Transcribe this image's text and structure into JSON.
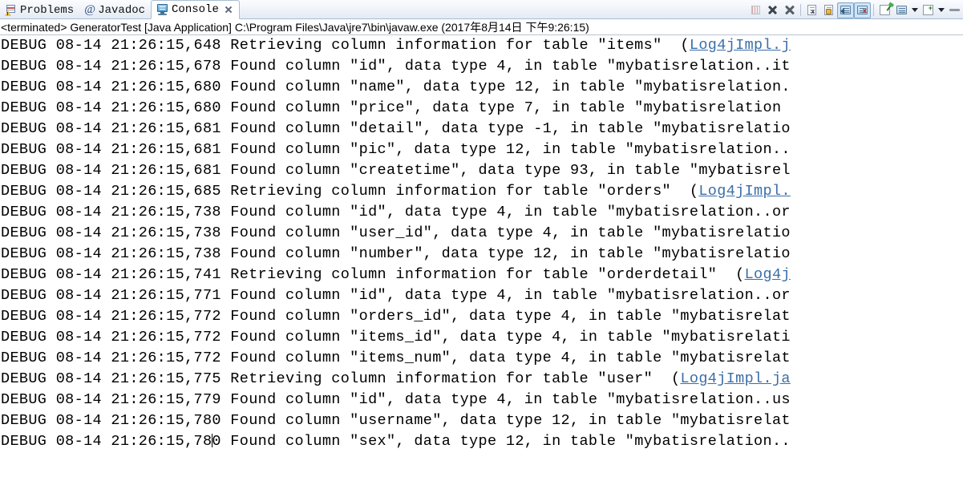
{
  "tabs": [
    {
      "label": "Problems",
      "icon": "problems-icon",
      "active": false,
      "closable": false
    },
    {
      "label": "Javadoc",
      "icon": "javadoc-icon",
      "active": false,
      "closable": false
    },
    {
      "label": "Console",
      "icon": "console-icon",
      "active": true,
      "closable": true
    }
  ],
  "toolbar": {
    "buttons": [
      {
        "name": "terminate-all-button",
        "icon": "bars-icon",
        "toggled": false
      },
      {
        "name": "remove-launch-button",
        "icon": "x-icon",
        "toggled": false
      },
      {
        "name": "remove-all-terminated-button",
        "icon": "double-x-icon",
        "toggled": false
      },
      {
        "name": "clear-console-button",
        "icon": "clear-console-icon",
        "toggled": false
      },
      {
        "name": "scroll-lock-button",
        "icon": "scroll-lock-icon",
        "toggled": false
      },
      {
        "name": "show-console-on-output-button",
        "icon": "show-console-output-icon",
        "toggled": true
      },
      {
        "name": "show-console-on-error-button",
        "icon": "show-console-error-icon",
        "toggled": true
      },
      {
        "name": "pin-console-button",
        "icon": "pin-console-icon",
        "toggled": false
      },
      {
        "name": "display-selected-console-button",
        "icon": "display-console-icon",
        "toggled": false
      },
      {
        "name": "display-selected-console-menu-button",
        "icon": "chevron-down-icon",
        "toggled": false
      },
      {
        "name": "open-console-button",
        "icon": "new-console-icon",
        "toggled": false
      },
      {
        "name": "open-console-menu-button",
        "icon": "chevron-down-icon",
        "toggled": false
      },
      {
        "name": "minimize-view-button",
        "icon": "minimize-icon",
        "toggled": false
      }
    ]
  },
  "process": {
    "header": "<terminated> GeneratorTest [Java Application] C:\\Program Files\\Java\\jre7\\bin\\javaw.exe (2017年8月14日 下午9:26:15)"
  },
  "console": {
    "link_color": "#3b6ea8",
    "lines": [
      {
        "text": "DEBUG 08-14 21:26:15,648 Retrieving column information for table \"items\"  (",
        "link": "Log4jImpl.j",
        "tail": ""
      },
      {
        "text": "DEBUG 08-14 21:26:15,678 Found column \"id\", data type 4, in table \"mybatisrelation..it",
        "link": "",
        "tail": ""
      },
      {
        "text": "DEBUG 08-14 21:26:15,680 Found column \"name\", data type 12, in table \"mybatisrelation.",
        "link": "",
        "tail": ""
      },
      {
        "text": "DEBUG 08-14 21:26:15,680 Found column \"price\", data type 7, in table \"mybatisrelation",
        "link": "",
        "tail": ""
      },
      {
        "text": "DEBUG 08-14 21:26:15,681 Found column \"detail\", data type -1, in table \"mybatisrelatio",
        "link": "",
        "tail": ""
      },
      {
        "text": "DEBUG 08-14 21:26:15,681 Found column \"pic\", data type 12, in table \"mybatisrelation..",
        "link": "",
        "tail": ""
      },
      {
        "text": "DEBUG 08-14 21:26:15,681 Found column \"createtime\", data type 93, in table \"mybatisrel",
        "link": "",
        "tail": ""
      },
      {
        "text": "DEBUG 08-14 21:26:15,685 Retrieving column information for table \"orders\"  (",
        "link": "Log4jImpl.",
        "tail": ""
      },
      {
        "text": "DEBUG 08-14 21:26:15,738 Found column \"id\", data type 4, in table \"mybatisrelation..or",
        "link": "",
        "tail": ""
      },
      {
        "text": "DEBUG 08-14 21:26:15,738 Found column \"user_id\", data type 4, in table \"mybatisrelatio",
        "link": "",
        "tail": ""
      },
      {
        "text": "DEBUG 08-14 21:26:15,738 Found column \"number\", data type 12, in table \"mybatisrelatio",
        "link": "",
        "tail": ""
      },
      {
        "text": "DEBUG 08-14 21:26:15,741 Retrieving column information for table \"orderdetail\"  (",
        "link": "Log4j",
        "tail": ""
      },
      {
        "text": "DEBUG 08-14 21:26:15,771 Found column \"id\", data type 4, in table \"mybatisrelation..or",
        "link": "",
        "tail": ""
      },
      {
        "text": "DEBUG 08-14 21:26:15,772 Found column \"orders_id\", data type 4, in table \"mybatisrelat",
        "link": "",
        "tail": ""
      },
      {
        "text": "DEBUG 08-14 21:26:15,772 Found column \"items_id\", data type 4, in table \"mybatisrelati",
        "link": "",
        "tail": ""
      },
      {
        "text": "DEBUG 08-14 21:26:15,772 Found column \"items_num\", data type 4, in table \"mybatisrelat",
        "link": "",
        "tail": ""
      },
      {
        "text": "DEBUG 08-14 21:26:15,775 Retrieving column information for table \"user\"  (",
        "link": "Log4jImpl.ja",
        "tail": ""
      },
      {
        "text": "DEBUG 08-14 21:26:15,779 Found column \"id\", data type 4, in table \"mybatisrelation..us",
        "link": "",
        "tail": ""
      },
      {
        "text": "DEBUG 08-14 21:26:15,780 Found column \"username\", data type 12, in table \"mybatisrelat",
        "link": "",
        "tail": ""
      },
      {
        "text": "DEBUG 08-14 21:26:15,78",
        "caret": true,
        "after_caret": "0 Found column \"sex\", data type 12, in table \"mybatisrelation..",
        "link": "",
        "tail": ""
      }
    ]
  }
}
